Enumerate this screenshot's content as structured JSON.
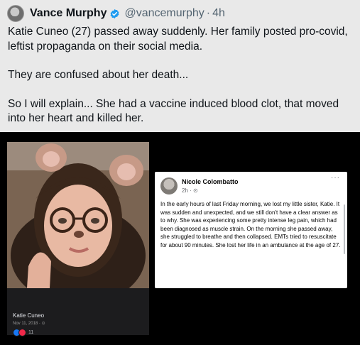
{
  "tweet": {
    "display_name": "Vance Murphy",
    "handle": "@vancemurphy",
    "separator": "·",
    "time": "4h",
    "lines": [
      "Katie Cuneo (27) passed away suddenly. Her family posted pro-covid, leftist propaganda on their social media.",
      "They are confused about her death...",
      "So I will explain... She had a vaccine induced blood clot, that moved into her heart and killed her."
    ]
  },
  "photo_card": {
    "name": "Katie Cuneo",
    "date": "Nov 11, 2018 · ⊙",
    "reaction_count": "11"
  },
  "fb_post": {
    "author": "Nicole Colombatto",
    "meta": "2h · ⊙",
    "more": "···",
    "body": "In the early hours of last Friday morning, we lost my little sister, Katie. It was sudden and unexpected, and we still don't have a clear answer as to why. She was experiencing some pretty intense leg pain, which had been diagnosed as muscle strain. On the morning she passed away, she struggled to breathe and then collapsed. EMTs tried to resuscitate for about 90 minutes. She lost her life in an ambulance at the age of 27."
  },
  "colors": {
    "verified": "#1d9bf0",
    "tweet_bg": "#e9e9e9",
    "media_bg": "#000000"
  }
}
